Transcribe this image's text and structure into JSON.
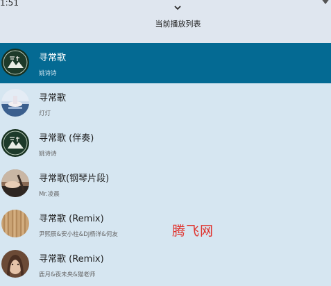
{
  "status_bar": {
    "time": "1:51",
    "signal_icon": "signal-icon"
  },
  "header": {
    "collapse_icon": "chevron-down-icon",
    "title": "当前播放列表"
  },
  "playlist": [
    {
      "title": "寻常歌",
      "artist": "姚诗诗",
      "active": true
    },
    {
      "title": "寻常歌",
      "artist": "灯灯",
      "active": false
    },
    {
      "title": "寻常歌 (伴奏)",
      "artist": "姚诗诗",
      "active": false
    },
    {
      "title": "寻常歌(钢琴片段)",
      "artist": "Mr.凌晨",
      "active": false
    },
    {
      "title": "寻常歌 (Remix)",
      "artist": "尹熙辰&安小柱&DJ杨洋&何友",
      "active": false
    },
    {
      "title": "寻常歌 (Remix)",
      "artist": "鹿月&夜未央&猫老师",
      "active": false
    }
  ],
  "watermark": "腾飞网",
  "colors": {
    "active_row": "#046a93",
    "list_background": "#d6e6f1",
    "header_background": "#dfe6ef",
    "watermark": "#e0312b"
  }
}
